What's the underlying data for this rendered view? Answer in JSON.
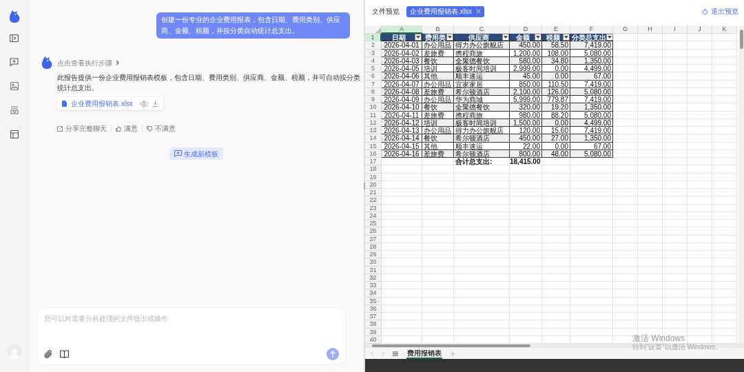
{
  "chat": {
    "user_message": "创建一份专业的企业费用报表，包含日期、费用类别、供应商、金额、税额，并按分类自动统计总支出。",
    "reply": {
      "steps_link": "点击查看执行步骤",
      "text": "此报告提供一份企业费用报销表模板，包含日期、费用类别、供应商、金额、税额，并可自动按分类统计总支出。",
      "file": {
        "name": "企业费用报销表.xlsx"
      },
      "feedback": [
        {
          "kind": "share",
          "label": "分享完整聊天"
        },
        {
          "kind": "like",
          "label": "满意"
        },
        {
          "kind": "dislike",
          "label": "不满意"
        }
      ]
    },
    "generate_button": "生成新模板",
    "input": {
      "placeholder": "您可以对需要分析处理的文件提出或操作"
    }
  },
  "preview": {
    "label": "文件预览",
    "tab": {
      "label": "企业费用报销表.xlsx"
    },
    "exit_button": "退出预览",
    "sheet": {
      "columns": [
        {
          "label": "A",
          "selected": true
        },
        {
          "label": "B",
          "selected": false
        },
        {
          "label": "C",
          "selected": false
        },
        {
          "label": "D",
          "selected": false
        },
        {
          "label": "E",
          "selected": false
        },
        {
          "label": "F",
          "selected": false
        },
        {
          "label": "G",
          "selected": false
        },
        {
          "label": "H",
          "selected": false
        },
        {
          "label": "I",
          "selected": false
        },
        {
          "label": "J",
          "selected": false
        },
        {
          "label": "K",
          "selected": false
        }
      ],
      "row_headers": [
        {
          "label": "1",
          "selected": true
        },
        {
          "label": "2",
          "selected": false
        },
        {
          "label": "3",
          "selected": false
        },
        {
          "label": "4",
          "selected": false
        },
        {
          "label": "5",
          "selected": false
        },
        {
          "label": "6",
          "selected": false
        },
        {
          "label": "7",
          "selected": false
        },
        {
          "label": "8",
          "selected": false
        },
        {
          "label": "9",
          "selected": false
        },
        {
          "label": "10",
          "selected": false
        },
        {
          "label": "11",
          "selected": false
        },
        {
          "label": "12",
          "selected": false
        },
        {
          "label": "13",
          "selected": false
        },
        {
          "label": "14",
          "selected": false
        },
        {
          "label": "15",
          "selected": false
        },
        {
          "label": "16",
          "selected": false
        },
        {
          "label": "17",
          "selected": false
        },
        {
          "label": "18",
          "selected": false
        },
        {
          "label": "19",
          "selected": false
        },
        {
          "label": "20",
          "selected": false
        },
        {
          "label": "21",
          "selected": false
        },
        {
          "label": "22",
          "selected": false
        },
        {
          "label": "23",
          "selected": false
        },
        {
          "label": "24",
          "selected": false
        },
        {
          "label": "25",
          "selected": false
        },
        {
          "label": "26",
          "selected": false
        },
        {
          "label": "27",
          "selected": false
        },
        {
          "label": "28",
          "selected": false
        },
        {
          "label": "29",
          "selected": false
        },
        {
          "label": "30",
          "selected": false
        },
        {
          "label": "31",
          "selected": false
        },
        {
          "label": "32",
          "selected": false
        },
        {
          "label": "33",
          "selected": false
        },
        {
          "label": "34",
          "selected": false
        },
        {
          "label": "35",
          "selected": false
        },
        {
          "label": "36",
          "selected": false
        },
        {
          "label": "37",
          "selected": false
        },
        {
          "label": "38",
          "selected": false
        },
        {
          "label": "39",
          "selected": false
        },
        {
          "label": "40",
          "selected": false
        }
      ],
      "header": [
        "日期",
        "费用类",
        "供应商",
        "金额",
        "税额",
        "分类总支出"
      ],
      "rows": [
        [
          "2026-04-01",
          "办公用品",
          "得力办公旗舰店",
          "450.00",
          "58.50",
          "7,419.00"
        ],
        [
          "2026-04-02",
          "差旅费",
          "携程商旅",
          "1,200.00",
          "108.00",
          "5,080.00"
        ],
        [
          "2026-04-03",
          "餐饮",
          "全聚德餐饮",
          "580.00",
          "34.80",
          "1,350.00"
        ],
        [
          "2026-04-05",
          "培训",
          "极客时间培训",
          "2,999.00",
          "0.00",
          "4,499.00"
        ],
        [
          "2026-04-06",
          "其他",
          "顺丰速运",
          "45.00",
          "0.00",
          "67.00"
        ],
        [
          "2026-04-07",
          "办公用品",
          "宜家家居",
          "850.00",
          "110.50",
          "7,419.00"
        ],
        [
          "2026-04-08",
          "差旅费",
          "希尔顿酒店",
          "2,100.00",
          "126.00",
          "5,080.00"
        ],
        [
          "2026-04-09",
          "办公用品",
          "华为商城",
          "5,999.00",
          "779.87",
          "7,419.00"
        ],
        [
          "2026-04-10",
          "餐饮",
          "全聚德餐饮",
          "320.00",
          "19.20",
          "1,350.00"
        ],
        [
          "2026-04-11",
          "差旅费",
          "携程商旅",
          "980.00",
          "88.20",
          "5,080.00"
        ],
        [
          "2026-04-12",
          "培训",
          "极客时间培训",
          "1,500.00",
          "0.00",
          "4,499.00"
        ],
        [
          "2026-04-13",
          "办公用品",
          "得力办公旗舰店",
          "120.00",
          "15.60",
          "7,419.00"
        ],
        [
          "2026-04-14",
          "餐饮",
          "希尔顿酒店",
          "450.00",
          "27.00",
          "1,350.00"
        ],
        [
          "2026-04-15",
          "其他",
          "顺丰速运",
          "22.00",
          "0.00",
          "67.00"
        ],
        [
          "2026-04-16",
          "差旅费",
          "希尔顿酒店",
          "800.00",
          "48.00",
          "5,080.00"
        ]
      ],
      "total": {
        "label": "合计总支出:",
        "value": "18,415.00"
      },
      "sheet_tabs": [
        {
          "label": "费用报销表",
          "selected": true
        }
      ]
    }
  },
  "os_notice": {
    "title": "激活 Windows",
    "subtitle": "转到“设置”以激活 Windows。"
  }
}
